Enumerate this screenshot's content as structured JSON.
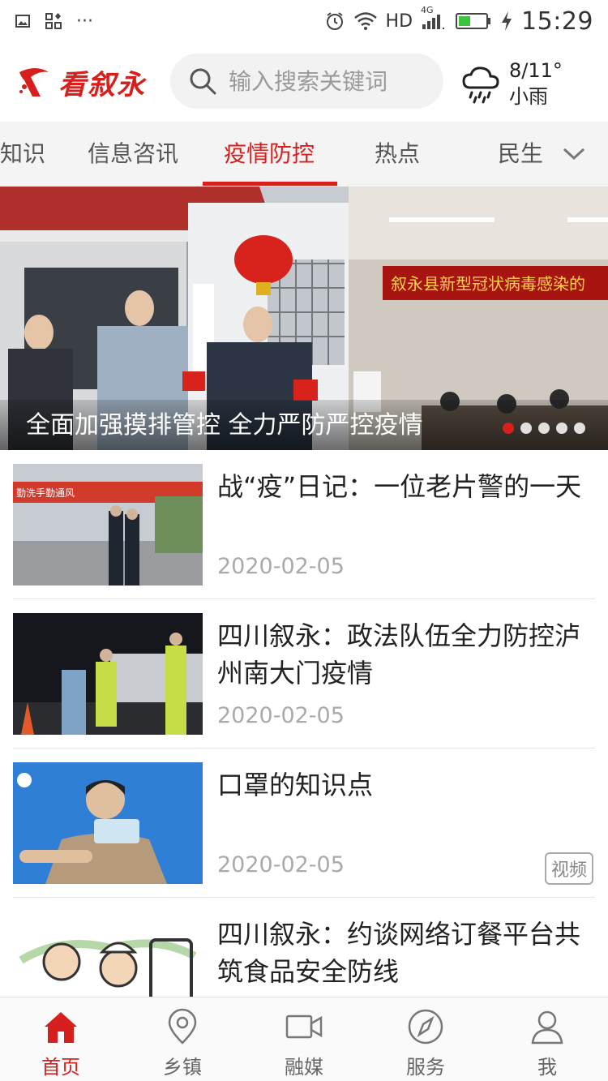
{
  "status_bar": {
    "network": "HD",
    "network_type": "4G",
    "time": "15:29"
  },
  "header": {
    "logo_text": "看叙永",
    "search": {
      "placeholder": "输入搜索关键词"
    },
    "weather": {
      "temp": "8/11°",
      "condition": "小雨",
      "icon": "rain-cloud-icon"
    }
  },
  "tabs": [
    {
      "label": "知识"
    },
    {
      "label": "信息咨讯"
    },
    {
      "label": "疫情防控",
      "active": true
    },
    {
      "label": "热点"
    },
    {
      "label": "民生"
    }
  ],
  "banner": {
    "caption": "全面加强摸排管控 全力严防严控疫情",
    "sign_text": "叙永县新型冠状病毒感染的",
    "current_slide": 1,
    "total_slides": 5
  },
  "news": [
    {
      "title": "战“疫”日记：一位老片警的一天",
      "date": "2020-02-05",
      "thumb_banner": "勤洗手勤通风",
      "tag": ""
    },
    {
      "title": "四川叙永：政法队伍全力防控泸州南大门疫情",
      "date": "2020-02-05",
      "tag": ""
    },
    {
      "title": "口罩的知识点",
      "date": "2020-02-05",
      "tag": "视频"
    },
    {
      "title": "四川叙永：约谈网络订餐平台共筑食品安全防线",
      "date": "",
      "tag": ""
    }
  ],
  "bottom_nav": [
    {
      "label": "首页",
      "icon": "home-icon",
      "active": true
    },
    {
      "label": "乡镇",
      "icon": "location-pin-icon"
    },
    {
      "label": "融媒",
      "icon": "video-camera-icon"
    },
    {
      "label": "服务",
      "icon": "compass-icon"
    },
    {
      "label": "我",
      "icon": "person-icon"
    }
  ],
  "colors": {
    "accent": "#d7201e",
    "muted": "#aaaaaa"
  }
}
